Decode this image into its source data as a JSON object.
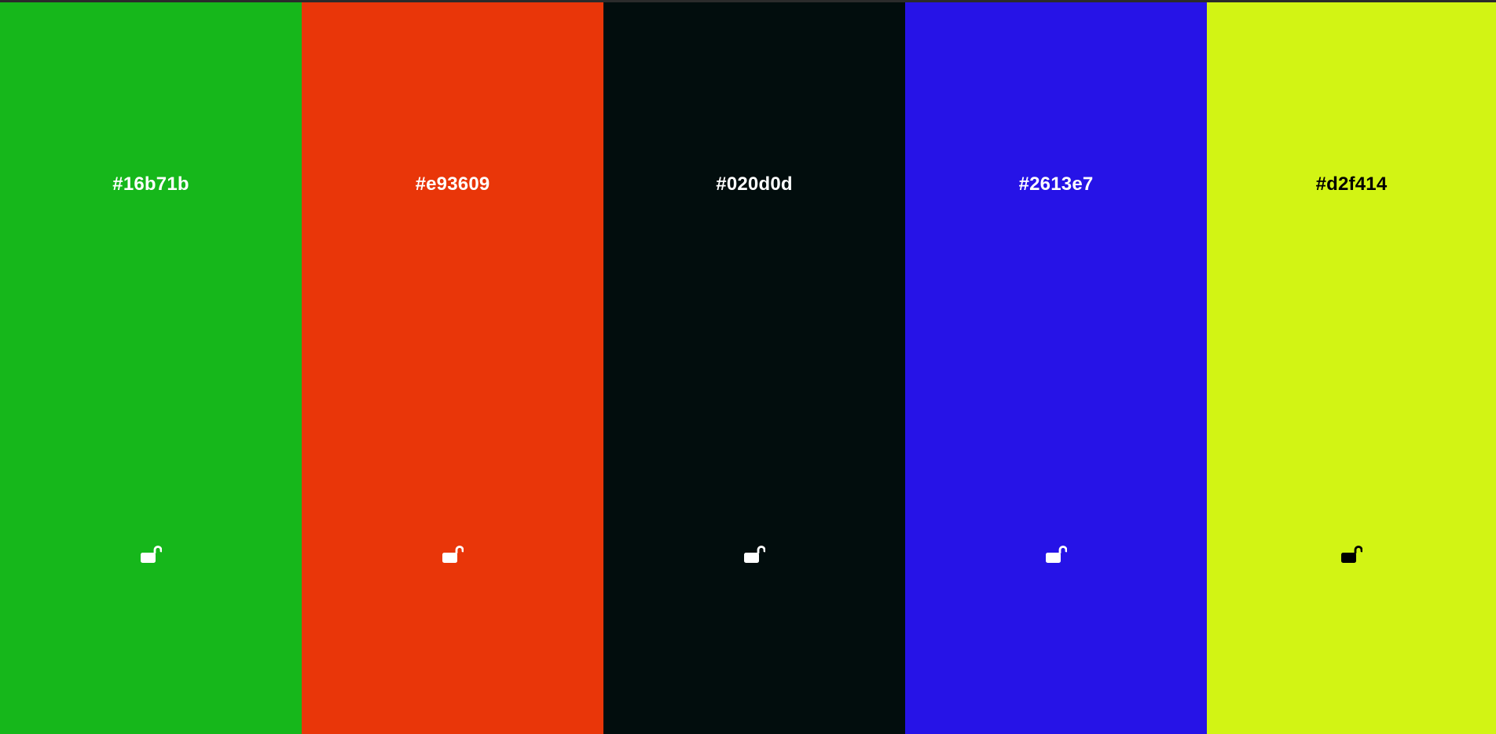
{
  "palette": {
    "swatches": [
      {
        "hex": "#16b71b",
        "background": "#16b71b",
        "text_color": "#ffffff",
        "lock_state": "unlocked",
        "icon": "lock-open-icon"
      },
      {
        "hex": "#e93609",
        "background": "#e93609",
        "text_color": "#ffffff",
        "lock_state": "unlocked",
        "icon": "lock-open-icon"
      },
      {
        "hex": "#020d0d",
        "background": "#020d0d",
        "text_color": "#ffffff",
        "lock_state": "unlocked",
        "icon": "lock-open-icon"
      },
      {
        "hex": "#2613e7",
        "background": "#2613e7",
        "text_color": "#ffffff",
        "lock_state": "unlocked",
        "icon": "lock-open-icon"
      },
      {
        "hex": "#d2f414",
        "background": "#d2f414",
        "text_color": "#000000",
        "lock_state": "unlocked",
        "icon": "lock-open-icon"
      }
    ]
  }
}
